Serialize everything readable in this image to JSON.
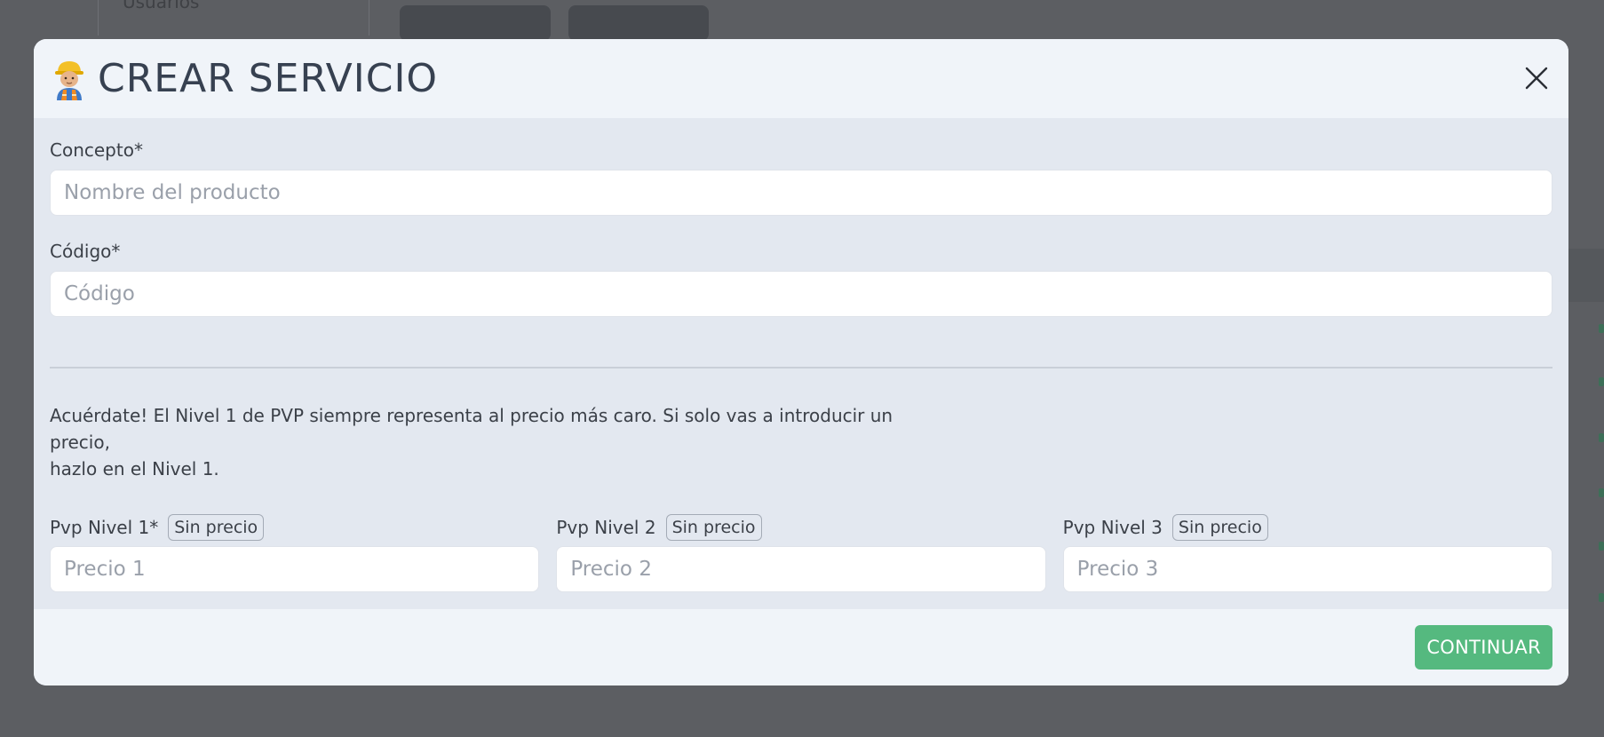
{
  "background": {
    "sidebar_label": "Usuarios"
  },
  "modal": {
    "header": {
      "icon": "construction-worker-icon",
      "title": "CREAR SERVICIO",
      "close_icon": "close-icon"
    },
    "fields": {
      "concepto": {
        "label": "Concepto*",
        "placeholder": "Nombre del producto",
        "value": ""
      },
      "codigo": {
        "label": "Código*",
        "placeholder": "Código",
        "value": ""
      }
    },
    "notice": {
      "line1": "Acuérdate! El Nivel 1 de PVP siempre representa al precio más caro. Si solo vas a introducir un precio,",
      "line2": "hazlo en el Nivel 1."
    },
    "prices": [
      {
        "label": "Pvp Nivel 1*",
        "badge": "Sin precio",
        "placeholder": "Precio 1"
      },
      {
        "label": "Pvp Nivel 2",
        "badge": "Sin precio",
        "placeholder": "Precio 2"
      },
      {
        "label": "Pvp Nivel 3",
        "badge": "Sin precio",
        "placeholder": "Precio 3"
      }
    ],
    "footer": {
      "continue_label": "CONTINUAR"
    }
  },
  "colors": {
    "accent_green": "#55b97f",
    "text": "#374151",
    "overlay": "#5c5e62"
  }
}
